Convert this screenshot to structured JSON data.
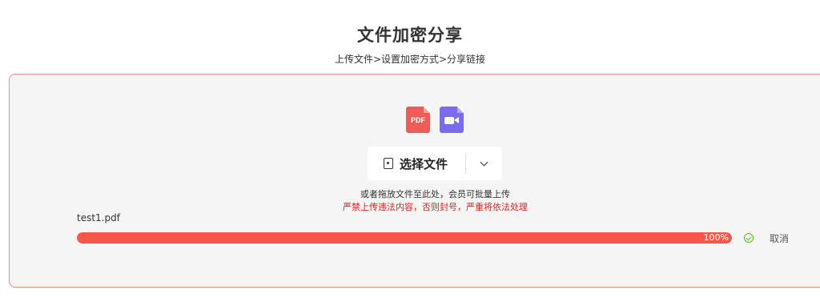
{
  "header": {
    "title": "文件加密分享",
    "steps": "上传文件>设置加密方式>分享链接"
  },
  "upload": {
    "icons": [
      {
        "name": "pdf-icon",
        "label": "PDF",
        "color": "#ef5b57"
      },
      {
        "name": "video-icon",
        "color": "#7a6cf2"
      }
    ],
    "select_label": "选择文件",
    "hint": "或者拖放文件至此处，会员可批量上传",
    "warning": "严禁上传违法内容，否则封号，严重将依法处理"
  },
  "file": {
    "name": "test1.pdf",
    "progress_percent": 100,
    "progress_text": "100%",
    "cancel_label": "取消"
  },
  "colors": {
    "accent": "#f5584a",
    "panel_border": "#f08a7a",
    "warning": "#e02020",
    "success": "#52c41a"
  }
}
